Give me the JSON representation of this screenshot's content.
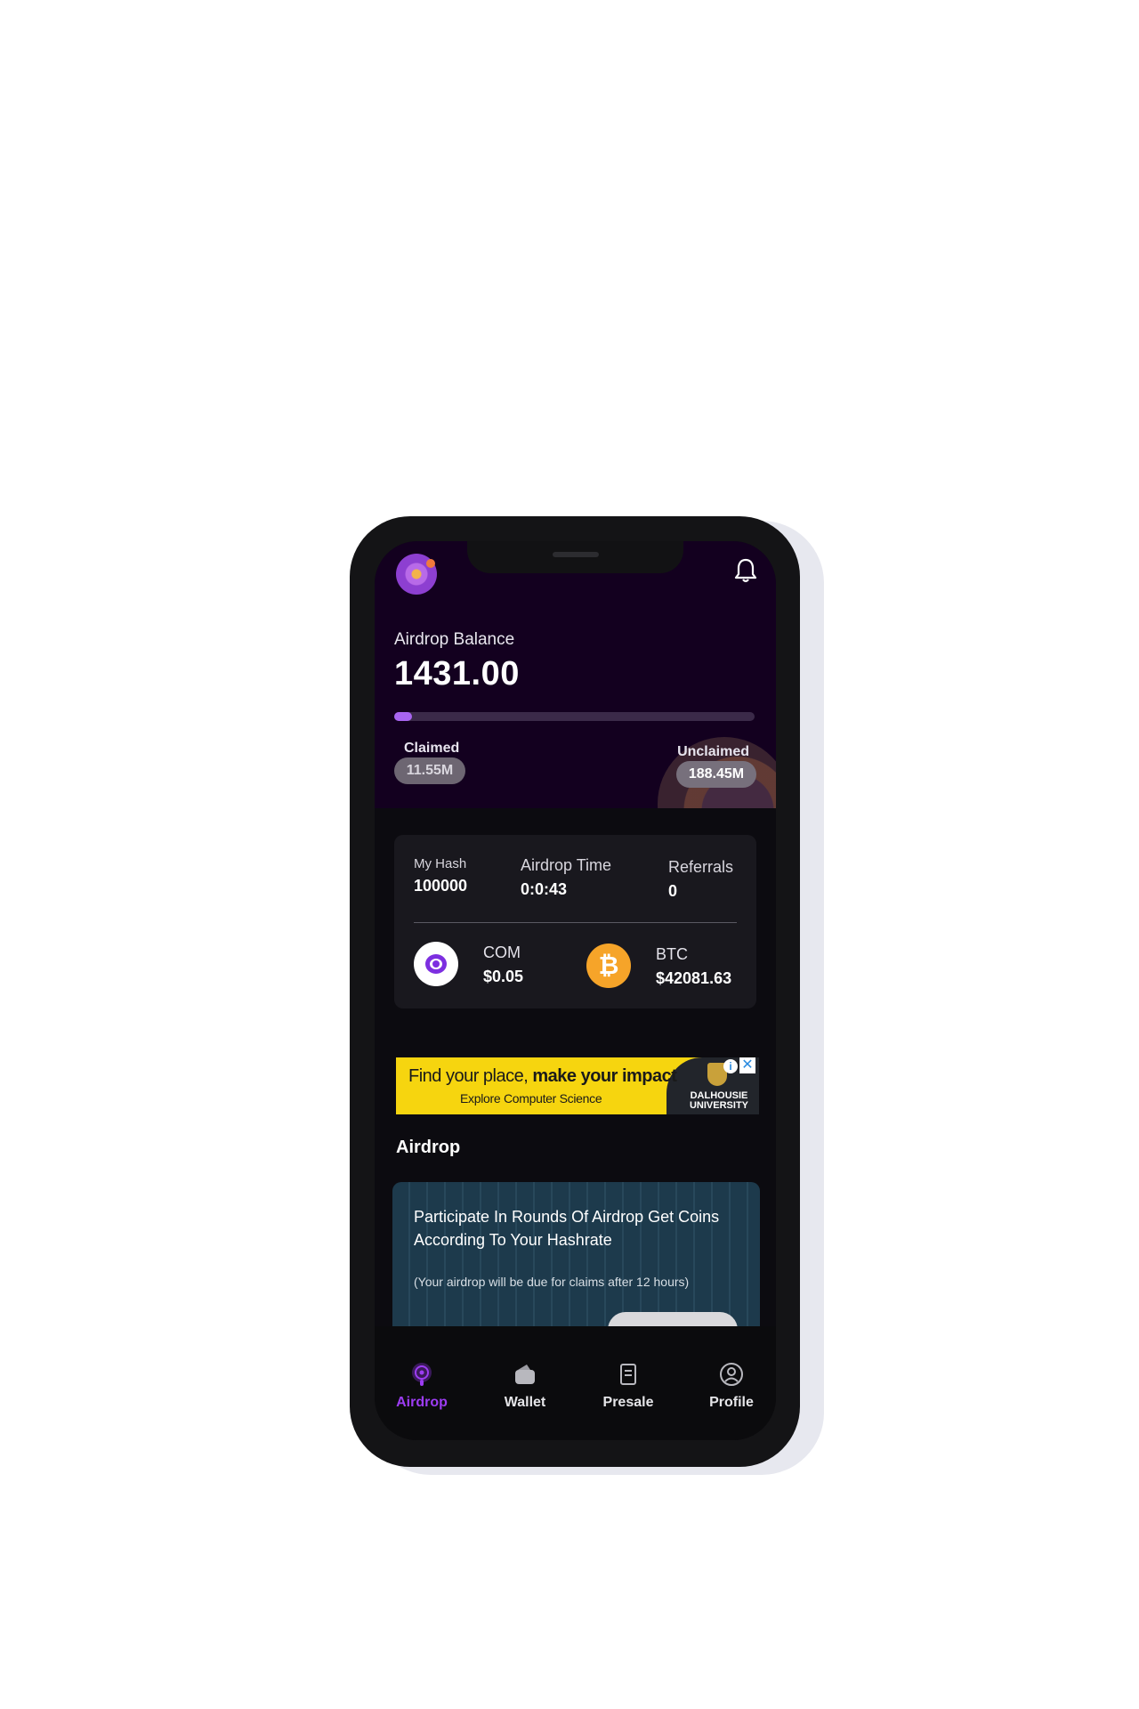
{
  "header": {
    "balance_label": "Airdrop Balance",
    "balance_value": "1431.00",
    "progress_fraction": 0.05,
    "claimed_label": "Claimed",
    "claimed_value": "11.55M",
    "unclaimed_label": "Unclaimed",
    "unclaimed_value": "188.45M"
  },
  "stats": {
    "hash_label": "My Hash",
    "hash_value": "100000",
    "time_label": "Airdrop Time",
    "time_value": "0:0:43",
    "referrals_label": "Referrals",
    "referrals_value": "0"
  },
  "coins": {
    "com_name": "COM",
    "com_price": "$0.05",
    "btc_name": "BTC",
    "btc_price": "$42081.63",
    "btc_symbol": "₿"
  },
  "ad": {
    "headline_regular": "Find your place, ",
    "headline_bold": "make your impact",
    "subline": "Explore Computer Science",
    "brand_line1": "DALHOUSIE",
    "brand_line2": "UNIVERSITY",
    "info_glyph": "i",
    "close_glyph": "✕"
  },
  "airdrop": {
    "section_title": "Airdrop",
    "description": "Participate In Rounds Of Airdrop Get Coins According To Your Hashrate",
    "note": "(Your airdrop will be due for claims after 12 hours)"
  },
  "nav": {
    "items": [
      {
        "label": "Airdrop",
        "icon": "airdrop-icon",
        "active": true
      },
      {
        "label": "Wallet",
        "icon": "wallet-icon"
      },
      {
        "label": "Presale",
        "icon": "presale-icon"
      },
      {
        "label": "Profile",
        "icon": "profile-icon"
      }
    ]
  },
  "colors": {
    "accent": "#9d3cf3",
    "header_bg": "#13001f",
    "card_bg": "#19181e",
    "btc_orange": "#f6a429",
    "ad_yellow": "#f6d50f"
  }
}
